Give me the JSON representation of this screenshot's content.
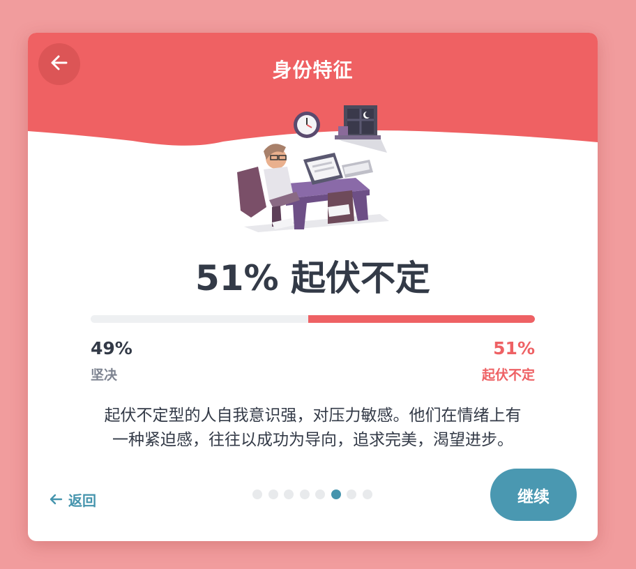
{
  "header": {
    "title": "身份特征",
    "back_icon": "arrow-left-icon",
    "background_color": "#ef6163"
  },
  "illustration": {
    "icon": "stressed-person-at-desk-illustration"
  },
  "result": {
    "headline": "51% 起伏不定",
    "left_percent_text": "49%",
    "left_label": "坚决",
    "right_percent_text": "51%",
    "right_label": "起伏不定",
    "right_fraction": 0.51,
    "bar_color": "#ee6164"
  },
  "description": {
    "line1": "起伏不定型的人自我意识强，对压力敏感。他们在情绪上有",
    "line2": "一种紧迫感，往往以成功为导向，追求完美，渴望进步。"
  },
  "footer": {
    "back_label": "返回",
    "back_icon": "arrow-left-icon",
    "continue_label": "继续",
    "accent_color": "#4a98b1",
    "pagination": {
      "total": 8,
      "current": 6
    }
  }
}
